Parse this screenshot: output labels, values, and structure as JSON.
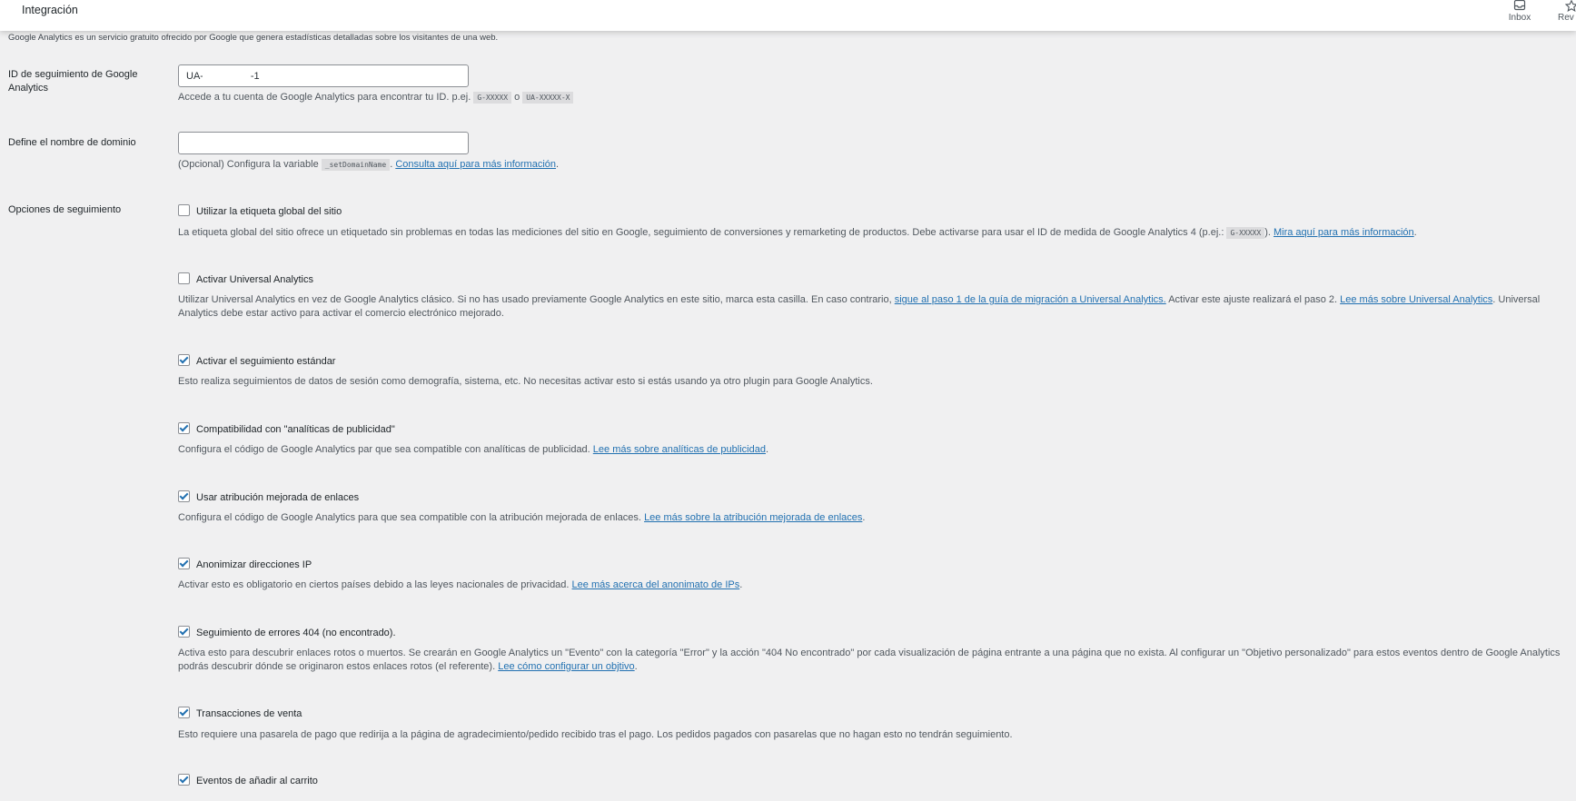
{
  "topbar": {
    "title": "Integración",
    "inbox_label": "Inbox",
    "inbox_icon": "inbox-icon",
    "rev_label": "Rev",
    "rev_icon": "star-icon"
  },
  "intro": "Google Analytics es un servicio gratuito ofrecido por Google que genera estadísticas detalladas sobre los visitantes de una web.",
  "tracking_id": {
    "label": "ID de seguimiento de Google Analytics",
    "value": "UA-                 -1",
    "desc": "Accede a tu cuenta de Google Analytics para encontrar tu ID. p.ej.",
    "example1": "G-XXXXX",
    "or": "o",
    "example2": "UA-XXXXX-X"
  },
  "domain": {
    "label": "Define el nombre de dominio",
    "value": "",
    "desc_before": "(Opcional) Configura la variable",
    "code": "_setDomainName",
    "desc_dot": ".",
    "link": "Consulta aquí para más información",
    "desc_end": "."
  },
  "tracking_options_label": "Opciones de seguimiento",
  "options": {
    "gtag": {
      "label": "Utilizar la etiqueta global del sitio",
      "checked": false,
      "desc_before": "La etiqueta global del sitio ofrece un etiquetado sin problemas en todas las mediciones del sitio en Google, seguimiento de conversiones y remarketing de productos. Debe activarse para usar el ID de medida de Google Analytics 4 (p.ej.:",
      "code": "G-XXXXX",
      "desc_mid": ").",
      "link": "Mira aquí para más información",
      "desc_end": "."
    },
    "universal": {
      "label": "Activar Universal Analytics",
      "checked": false,
      "desc_before": "Utilizar Universal Analytics en vez de Google Analytics clásico. Si no has usado previamente Google Analytics en este sitio, marca esta casilla. En caso contrario,",
      "link1": "sigue al paso 1 de la guía de migración a Universal Analytics.",
      "desc_mid": "Activar este ajuste realizará el paso 2.",
      "link2": "Lee más sobre Universal Analytics",
      "desc_end": ". Universal Analytics debe estar activo para activar el comercio electrónico mejorado."
    },
    "standard": {
      "label": "Activar el seguimiento estándar",
      "checked": true,
      "desc": "Esto realiza seguimientos de datos de sesión como demografía, sistema, etc. No necesitas activar esto si estás usando ya otro plugin para Google Analytics."
    },
    "advertising": {
      "label": "Compatibilidad con \"analíticas de publicidad\"",
      "checked": true,
      "desc_before": "Configura el código de Google Analytics par que sea compatible con analíticas de publicidad.",
      "link": "Lee más sobre analíticas de publicidad",
      "desc_end": "."
    },
    "enhanced_link": {
      "label": "Usar atribución mejorada de enlaces",
      "checked": true,
      "desc_before": "Configura el código de Google Analytics para que sea compatible con la atribución mejorada de enlaces.",
      "link": "Lee más sobre la atribución mejorada de enlaces",
      "desc_end": "."
    },
    "anonymize": {
      "label": "Anonimizar direcciones IP",
      "checked": true,
      "desc_before": "Activar esto es obligatorio en ciertos países debido a las leyes nacionales de privacidad.",
      "link": "Lee más acerca del anonimato de IPs",
      "desc_end": "."
    },
    "errors404": {
      "label": "Seguimiento de errores 404 (no encontrado).",
      "checked": true,
      "desc_before": "Activa esto para descubrir enlaces rotos o muertos. Se crearán en Google Analytics un \"Evento\" con la categoría \"Error\" y la acción \"404 No encontrado\" por cada visualización de página entrante a una página que no exista. Al configurar un \"Objetivo personalizado\" para estos eventos dentro de Google Analytics podrás descubrir dónde se originaron estos enlaces rotos (el referente).",
      "link": "Lee cómo configurar un objtivo",
      "desc_end": "."
    },
    "transactions": {
      "label": "Transacciones de venta",
      "checked": true,
      "desc": "Esto requiere una pasarela de pago que redirija a la página de agradecimiento/pedido recibido tras el pago. Los pedidos pagados con pasarelas que no hagan esto no tendrán seguimiento."
    },
    "add_to_cart": {
      "label": "Eventos de añadir al carrito",
      "checked": true
    }
  },
  "colors": {
    "link": "#2271b1",
    "background": "#f0f0f1",
    "text": "#1d2327",
    "muted": "#50575e"
  }
}
